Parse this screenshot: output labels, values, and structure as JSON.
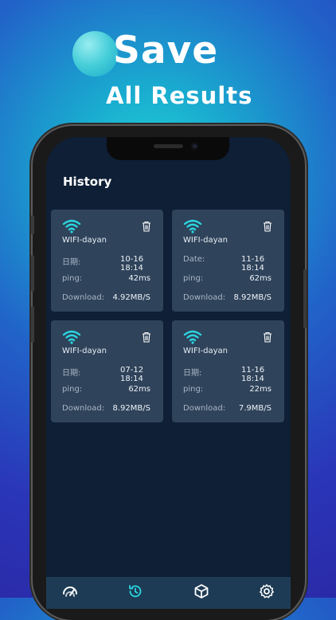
{
  "promo": {
    "line1": "Save",
    "line2": "All Results"
  },
  "screen": {
    "title": "History",
    "cards": [
      {
        "ssid": "WIFI-dayan",
        "date_label": "日期:",
        "date_value": "10-16 18:14",
        "ping_label": "ping:",
        "ping_value": "42ms",
        "download_label": "Download:",
        "download_value": "4.92MB/S"
      },
      {
        "ssid": "WIFI-dayan",
        "date_label": "Date:",
        "date_value": "11-16 18:14",
        "ping_label": "ping:",
        "ping_value": "62ms",
        "download_label": "Download:",
        "download_value": "8.92MB/S"
      },
      {
        "ssid": "WIFI-dayan",
        "date_label": "日期:",
        "date_value": "07-12 18:14",
        "ping_label": "ping:",
        "ping_value": "62ms",
        "download_label": "Download:",
        "download_value": "8.92MB/S"
      },
      {
        "ssid": "WIFI-dayan",
        "date_label": "日期:",
        "date_value": "11-16 18:14",
        "ping_label": "ping:",
        "ping_value": "22ms",
        "download_label": "Download:",
        "download_value": "7.9MB/S"
      }
    ],
    "tabs": [
      {
        "icon": "speedometer-icon"
      },
      {
        "icon": "history-icon",
        "active": true
      },
      {
        "icon": "box-icon"
      },
      {
        "icon": "gear-icon"
      }
    ]
  },
  "colors": {
    "accent": "#2ad6e0",
    "card_bg": "#2f435a",
    "screen_bg": "#0e1f36",
    "tabbar_bg": "#1d3b55"
  }
}
